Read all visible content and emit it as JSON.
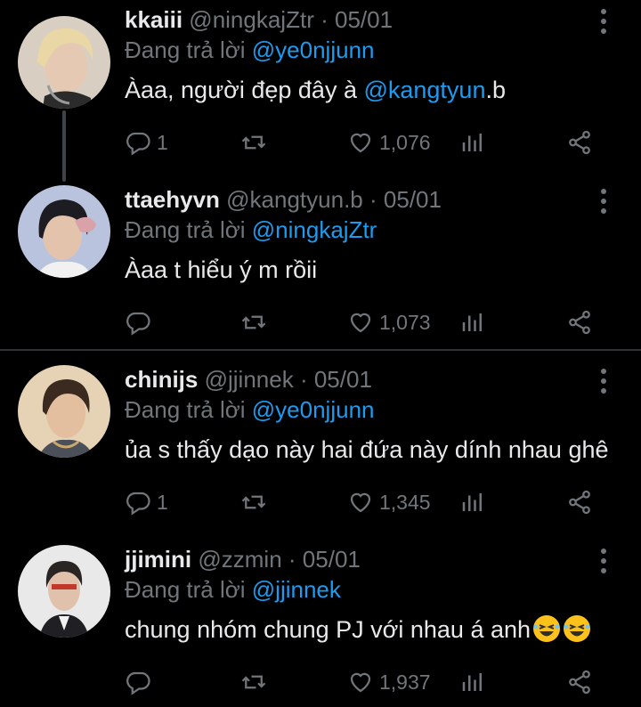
{
  "tweets": [
    {
      "name": "kkaiii",
      "handle": "@ningkajZtr",
      "sep": "·",
      "date": "05/01",
      "replying_prefix": "Đang trả lời ",
      "replying_to": "@ye0njjunn",
      "text_before": "Àaa, người đẹp đây à ",
      "text_mention": "@kangtyun",
      "text_after": ".b",
      "reply_count": "1",
      "like_count": "1,076",
      "avatar_colors": {
        "bg": "#d8cfc2",
        "hair": "#e9d7a6",
        "skin": "#e6c9b3"
      }
    },
    {
      "name": "ttaehyvn",
      "handle": "@kangtyun.b",
      "sep": "·",
      "date": "05/01",
      "replying_prefix": "Đang trả lời ",
      "replying_to": "@ningkajZtr",
      "text": "Àaa t hiểu ý m rồii",
      "reply_count": "",
      "like_count": "1,073",
      "avatar_colors": {
        "bg": "#b9c3dd",
        "hair": "#1c1c22",
        "skin": "#e4c3ad"
      }
    },
    {
      "name": "chinijs",
      "handle": "@jjinnek",
      "sep": "·",
      "date": "05/01",
      "replying_prefix": "Đang trả lời ",
      "replying_to": "@ye0njjunn",
      "text": "ủa s thấy dạo này hai đứa này dính nhau ghê",
      "reply_count": "1",
      "like_count": "1,345",
      "avatar_colors": {
        "bg": "#e6d2b4",
        "hair": "#3a2a20",
        "skin": "#e3bfa0"
      }
    },
    {
      "name": "jjimini",
      "handle": "@zzmin",
      "sep": "·",
      "date": "05/01",
      "replying_prefix": "Đang trả lời ",
      "replying_to": "@jjinnek",
      "text": "chung nhóm chung PJ với nhau á anh",
      "reply_count": "",
      "like_count": "1,937",
      "avatar_colors": {
        "bg": "#e9e9ea",
        "hair": "#2a2523",
        "skin": "#e0c2ac"
      }
    }
  ],
  "colors": {
    "background": "#000000",
    "text": "#e7e9ea",
    "muted": "#71767b",
    "link": "#1d9bf0"
  },
  "icons": [
    "reply-icon",
    "retweet-icon",
    "like-icon",
    "stats-icon",
    "share-icon",
    "more-icon",
    "laughing-emoji"
  ]
}
